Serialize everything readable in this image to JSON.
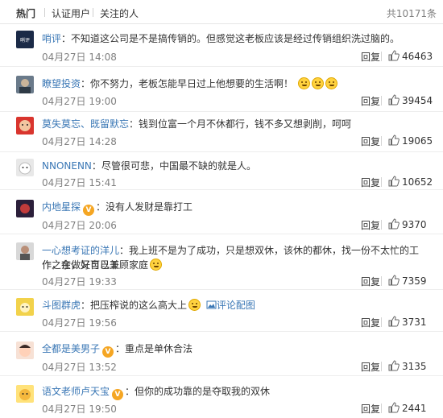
{
  "header": {
    "tabs": [
      {
        "label": "热门",
        "active": true
      },
      {
        "label": "认证用户",
        "active": false
      },
      {
        "label": "关注的人",
        "active": false
      }
    ],
    "total": "共10171条"
  },
  "comments": [
    {
      "user": "哨评",
      "text": "不知道这公司是不是搞传销的。但感觉这老板应该是经过传销组织洗过脑的。",
      "time": "04月27日 14:08",
      "reply": "回复",
      "likes": "46463"
    },
    {
      "user": "瞭望投资",
      "text": "你不努力，老板怎能早日过上他想要的生活啊！",
      "time": "04月27日 19:00",
      "reply": "回复",
      "likes": "39454",
      "emojis": 3
    },
    {
      "user": "莫失莫忘、既留默忘",
      "text": "钱到位富一个月不休都行，钱不多又想剥削，呵呵",
      "time": "04月27日 14:28",
      "reply": "回复",
      "likes": "19065"
    },
    {
      "user": "NNONENN",
      "text": "尽管很可悲，中国最不缺的就是人。",
      "time": "04月27日 15:41",
      "reply": "回复",
      "likes": "10652"
    },
    {
      "user": "内地星探",
      "text": "没有人发财是靠打工",
      "time": "04月27日 20:06",
      "reply": "回复",
      "likes": "9370",
      "badge": "V"
    },
    {
      "user": "一心想考证的洋儿",
      "text_line1": "我上班不是为了成功，只是想双休，该休的都休，找一份不太忙的工作，在做好自己工",
      "text_line2": "作之余，又可以兼顾家庭",
      "time": "04月27日 19:33",
      "reply": "回复",
      "likes": "7359",
      "emojis": 1
    },
    {
      "user": "斗图群虎",
      "text": "把压榨说的这么高大上",
      "time": "04月27日 19:56",
      "reply": "回复",
      "likes": "3731",
      "emojis": 1,
      "link": "评论配图"
    },
    {
      "user": "全都是美男子",
      "text": "重点是单休合法",
      "time": "04月27日 13:52",
      "reply": "回复",
      "likes": "3135",
      "badge": "V"
    },
    {
      "user": "语文老师卢天宝",
      "text": "但你的成功靠的是夺取我的双休",
      "time": "04月27日 19:50",
      "reply": "回复",
      "likes": "2441",
      "badge": "V"
    }
  ],
  "colors": {
    "link": "#3a77b5",
    "muted": "#808080",
    "badge": "#f5a623"
  },
  "icons": [
    "thumbs-up-icon",
    "smile-emoji-icon",
    "verified-badge-icon",
    "image-icon"
  ]
}
